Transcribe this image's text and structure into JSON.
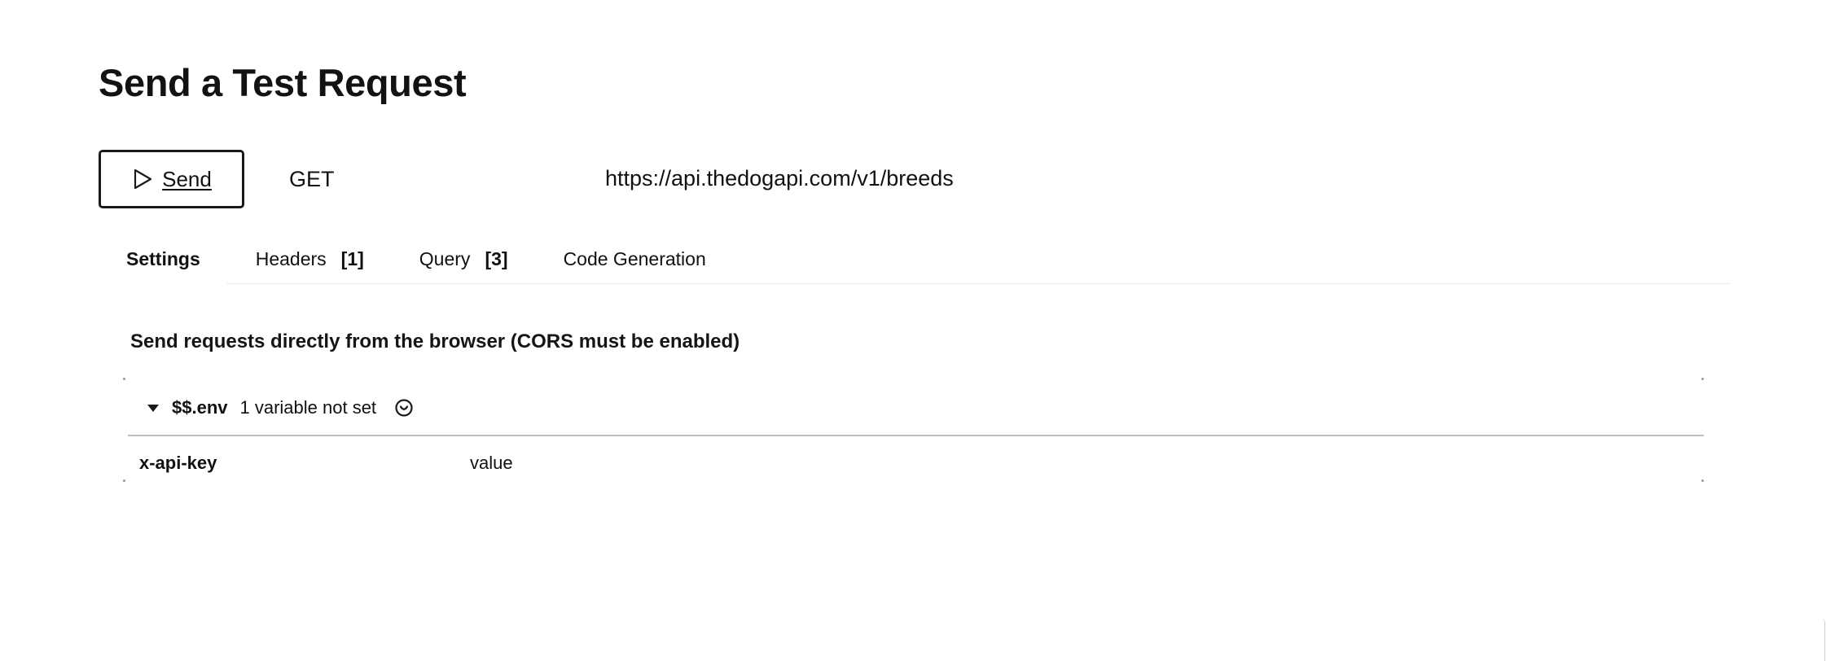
{
  "page": {
    "title": "Send a Test Request"
  },
  "request": {
    "send_label": "Send",
    "method": "GET",
    "url": "https://api.thedogapi.com/v1/breeds"
  },
  "tabs": [
    {
      "label": "Settings",
      "count": "",
      "active": true
    },
    {
      "label": "Headers",
      "count": "[1]",
      "active": false
    },
    {
      "label": "Query",
      "count": "[3]",
      "active": false
    },
    {
      "label": "Code Generation",
      "count": "",
      "active": false
    }
  ],
  "settings": {
    "cors_note": "Send requests directly from the browser (CORS must be enabled)",
    "env": {
      "name": "$$.env",
      "status": "1 variable not set",
      "expanded": true,
      "variables": [
        {
          "key": "x-api-key",
          "value_placeholder": "value"
        }
      ]
    }
  },
  "icons": {
    "send": "play-icon",
    "env_toggle": "caret-down-icon",
    "env_status": "smiley-icon"
  },
  "colors": {
    "text": "#111111",
    "border": "#1a1a1a",
    "divider": "#bdbdbd",
    "background": "#ffffff"
  }
}
